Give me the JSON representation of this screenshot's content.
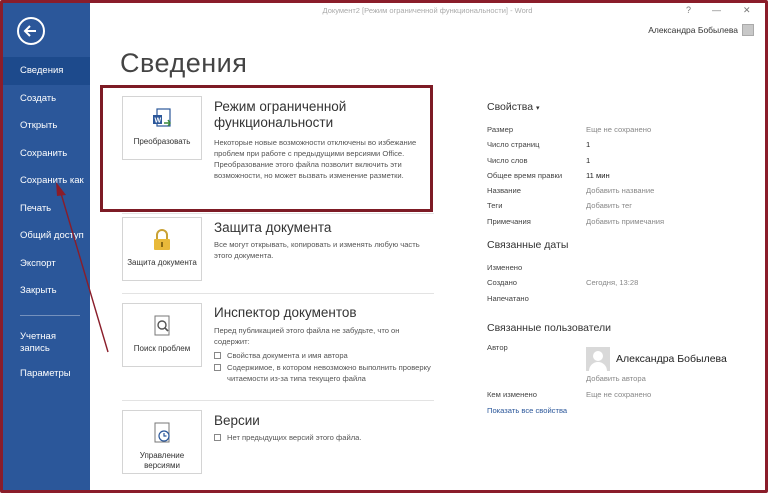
{
  "window": {
    "title": "Документ2 [Режим ограниченной функциональности] - Word",
    "help": "?",
    "minimize": "—",
    "close": "✕",
    "user_name": "Александра Бобылева"
  },
  "sidebar": {
    "items": [
      {
        "label": "Сведения"
      },
      {
        "label": "Создать"
      },
      {
        "label": "Открыть"
      },
      {
        "label": "Сохранить"
      },
      {
        "label": "Сохранить как"
      },
      {
        "label": "Печать"
      },
      {
        "label": "Общий доступ"
      },
      {
        "label": "Экспорт"
      },
      {
        "label": "Закрыть"
      },
      {
        "label": "Учетная запись"
      },
      {
        "label": "Параметры"
      }
    ]
  },
  "main": {
    "title": "Сведения",
    "compat": {
      "tile_label": "Преобразовать",
      "heading": "Режим ограниченной функциональности",
      "text": "Некоторые новые возможности отключены во избежание проблем при работе с предыдущими версиями Office. Преобразование этого файла позволит включить эти возможности, но может вызвать изменение разметки."
    },
    "protect": {
      "tile_label": "Защита документа",
      "heading": "Защита документа",
      "text": "Все могут открывать, копировать и изменять любую часть этого документа."
    },
    "inspect": {
      "tile_label": "Поиск проблем",
      "heading": "Инспектор документов",
      "text": "Перед публикацией этого файла не забудьте, что он содержит:",
      "bullet1": "Свойства документа и имя автора",
      "bullet2": "Содержимое, в котором невозможно выполнить проверку читаемости из-за типа текущего файла"
    },
    "versions": {
      "tile_label": "Управление версиями",
      "heading": "Версии",
      "text": "Нет предыдущих версий этого файла."
    }
  },
  "properties": {
    "heading": "Свойства",
    "rows": [
      {
        "k": "Размер",
        "v": "Еще не сохранено"
      },
      {
        "k": "Число страниц",
        "v": "1"
      },
      {
        "k": "Число слов",
        "v": "1"
      },
      {
        "k": "Общее время правки",
        "v": "11 мин"
      },
      {
        "k": "Название",
        "v": "Добавить название"
      },
      {
        "k": "Теги",
        "v": "Добавить тег"
      },
      {
        "k": "Примечания",
        "v": "Добавить примечания"
      }
    ],
    "dates_heading": "Связанные даты",
    "dates": [
      {
        "k": "Изменено",
        "v": ""
      },
      {
        "k": "Создано",
        "v": "Сегодня, 13:28"
      },
      {
        "k": "Напечатано",
        "v": ""
      }
    ],
    "people_heading": "Связанные пользователи",
    "author_label": "Автор",
    "author_name": "Александра Бобылева",
    "add_author": "Добавить автора",
    "changed_by_label": "Кем изменено",
    "changed_by_value": "Еще не сохранено",
    "show_all": "Показать все свойства"
  },
  "colors": {
    "sidebar": "#2b579a",
    "sidebar_active": "#1d4a8c",
    "highlight": "#7d1b25"
  }
}
